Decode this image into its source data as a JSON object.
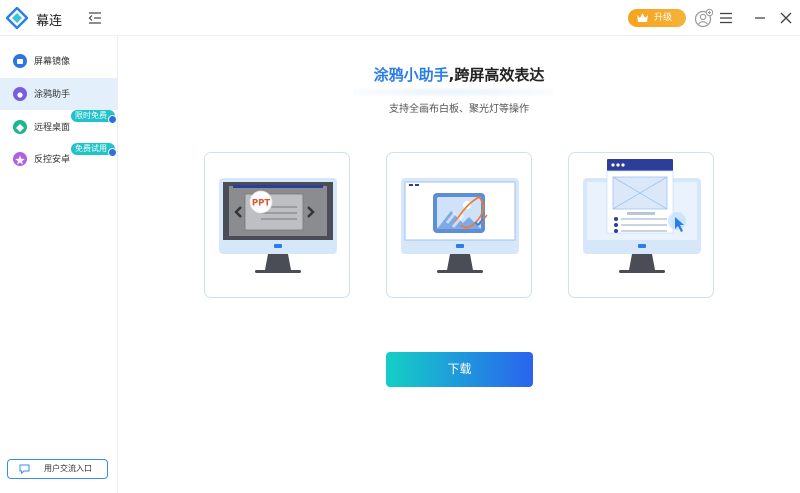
{
  "app": {
    "title": "幕连"
  },
  "titlebar": {
    "upgrade_label": "升级"
  },
  "sidebar": {
    "items": [
      {
        "label": "屏幕镜像",
        "color": "#2f74e0"
      },
      {
        "label": "涂鸦助手",
        "color": "#7a5ce0",
        "active": true
      },
      {
        "label": "远程桌面",
        "color": "#20b58e",
        "badge": "限时免费"
      },
      {
        "label": "反控安卓",
        "color": "#b25fe0",
        "badge": "免费试用"
      }
    ],
    "community_label": "用户交流入口"
  },
  "main": {
    "headline_highlight": "涂鸦小助手",
    "headline_rest": ",跨屏高效表达",
    "subtitle": "支持全画布白板、聚光灯等操作",
    "cards": [
      {
        "icon": "ppt-slide-monitor-illustration",
        "ppt_text": "PPT"
      },
      {
        "icon": "image-annotation-monitor-illustration"
      },
      {
        "icon": "web-spotlight-monitor-illustration"
      }
    ],
    "download_label": "下载"
  },
  "colors": {
    "accent": "#2b7de9",
    "active_bg": "#e3effb",
    "upgrade": "#f7a21b",
    "badge": "#20c3c7"
  }
}
